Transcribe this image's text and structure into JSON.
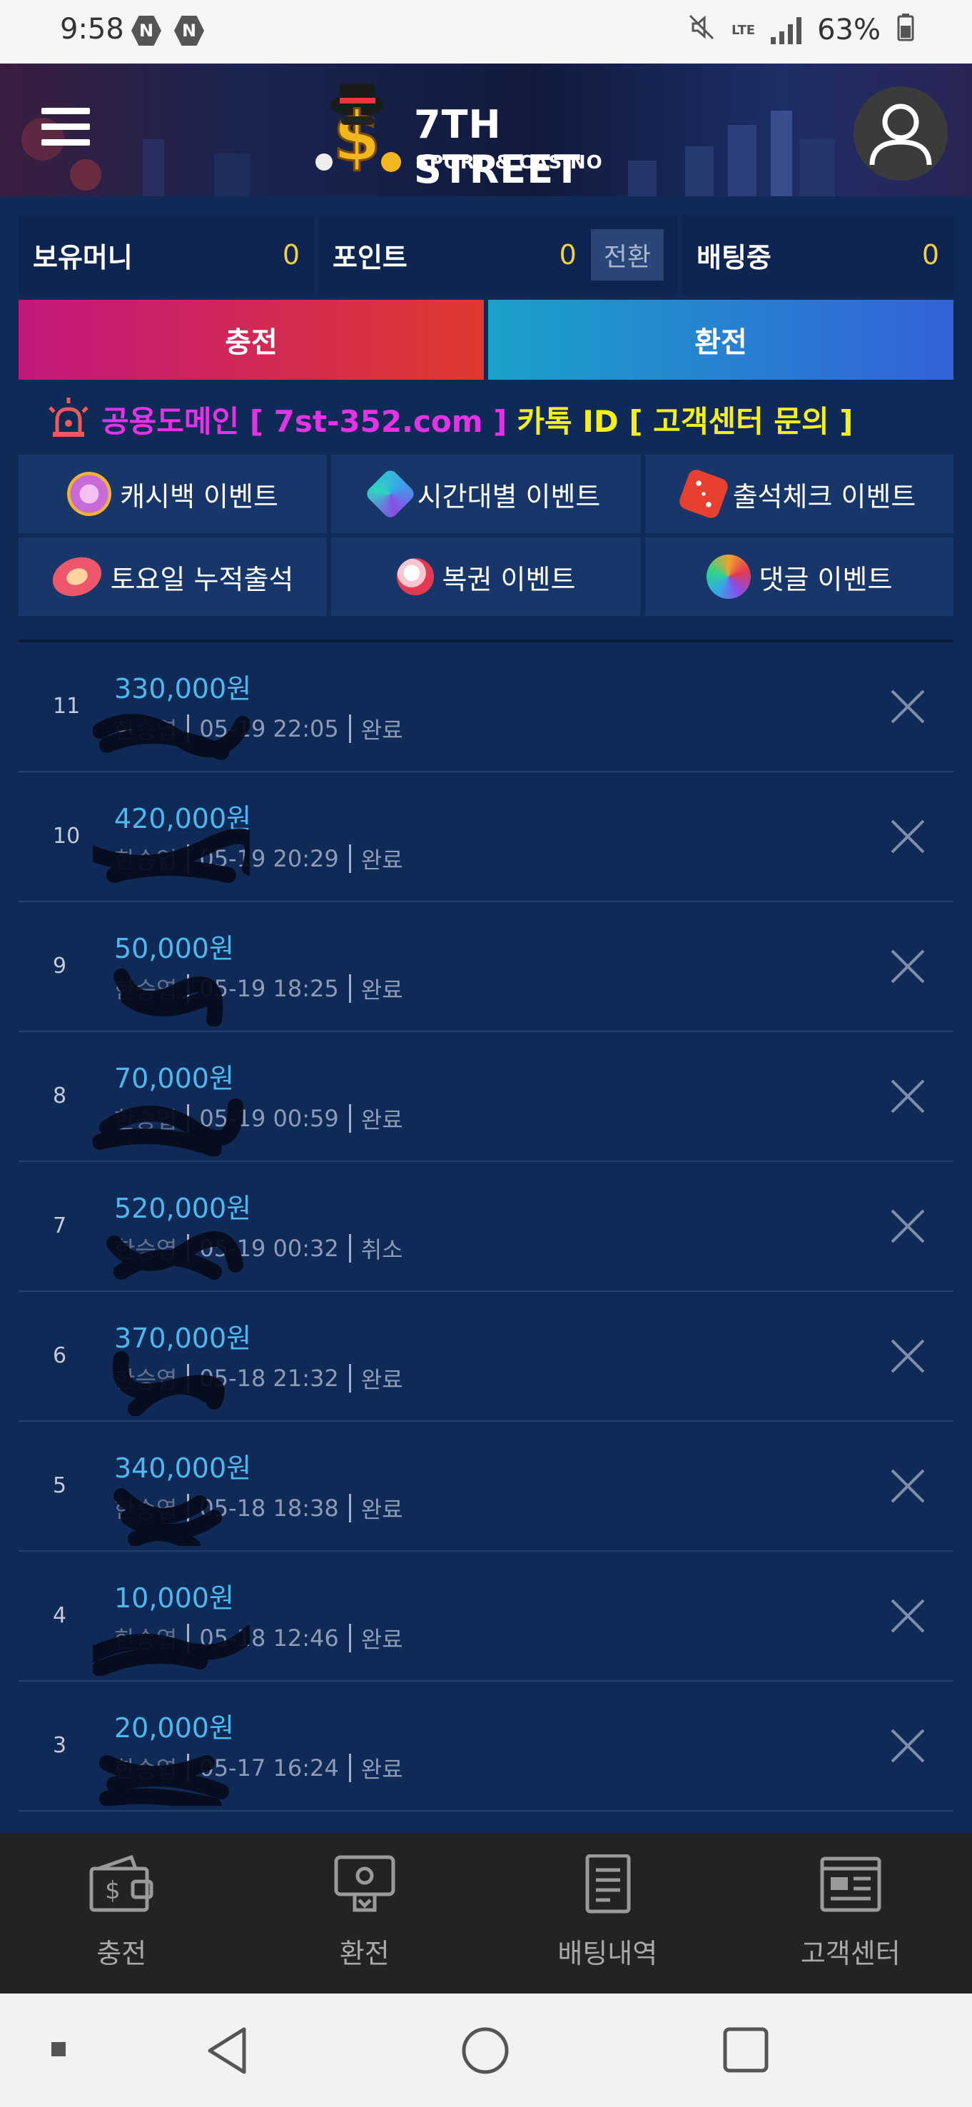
{
  "status_bar": {
    "time": "9:58",
    "badges": [
      "N",
      "N"
    ],
    "battery": "63%",
    "network": "LTE"
  },
  "header": {
    "brand_title": "7TH STREET",
    "brand_subtitle": "SPORT & CASINO"
  },
  "balance": {
    "money_label": "보유머니",
    "money_value": "0",
    "point_label": "포인트",
    "point_value": "0",
    "convert_label": "전환",
    "betting_label": "배팅중",
    "betting_value": "0"
  },
  "actions": {
    "charge_label": "충전",
    "exchange_label": "환전"
  },
  "notice": {
    "domain_prefix": "공용도메인 [ 7st-352.com ]",
    "kakao_text": "카톡 ID [ 고객센터 문의 ]"
  },
  "events": [
    {
      "label": "캐시백 이벤트",
      "icon": "cashback-chip-icon",
      "color": "#d48be0"
    },
    {
      "label": "시간대별 이벤트",
      "icon": "gem-swirl-icon",
      "color": "#36a6e8"
    },
    {
      "label": "출석체크 이벤트",
      "icon": "dice-icon",
      "color": "#e8402f"
    },
    {
      "label": "토요일 누적출석",
      "icon": "saturday-chip-icon",
      "color": "#f0566b"
    },
    {
      "label": "복권 이벤트",
      "icon": "lottery-ball-icon",
      "color": "#e23a52"
    },
    {
      "label": "댓글 이벤트",
      "icon": "comment-wheel-icon",
      "color": "#f0a12f"
    }
  ],
  "history": [
    {
      "index": "11",
      "amount": "330,000원",
      "name": "한승엽",
      "date": "05-19 22:05",
      "status": "완료"
    },
    {
      "index": "10",
      "amount": "420,000원",
      "name": "한승엽",
      "date": "05-19 20:29",
      "status": "완료"
    },
    {
      "index": "9",
      "amount": "50,000원",
      "name": "한승엽",
      "date": "05-19 18:25",
      "status": "완료"
    },
    {
      "index": "8",
      "amount": "70,000원",
      "name": "한승엽",
      "date": "05-19 00:59",
      "status": "완료"
    },
    {
      "index": "7",
      "amount": "520,000원",
      "name": "한승엽",
      "date": "05-19 00:32",
      "status": "취소"
    },
    {
      "index": "6",
      "amount": "370,000원",
      "name": "한승엽",
      "date": "05-18 21:32",
      "status": "완료"
    },
    {
      "index": "5",
      "amount": "340,000원",
      "name": "한승엽",
      "date": "05-18 18:38",
      "status": "완료"
    },
    {
      "index": "4",
      "amount": "10,000원",
      "name": "한승엽",
      "date": "05-18 12:46",
      "status": "완료"
    },
    {
      "index": "3",
      "amount": "20,000원",
      "name": "한승엽",
      "date": "05-17 16:24",
      "status": "완료"
    }
  ],
  "bottom_nav": [
    {
      "label": "충전",
      "icon": "wallet-icon"
    },
    {
      "label": "환전",
      "icon": "withdraw-icon"
    },
    {
      "label": "배팅내역",
      "icon": "document-icon"
    },
    {
      "label": "고객센터",
      "icon": "newspaper-icon"
    }
  ],
  "colors": {
    "background": "#102a57",
    "amount_text": "#4db7ee",
    "value_yellow": "#f4d03f",
    "notice_pink": "#e432e6",
    "notice_yellow": "#f6ef1b"
  }
}
